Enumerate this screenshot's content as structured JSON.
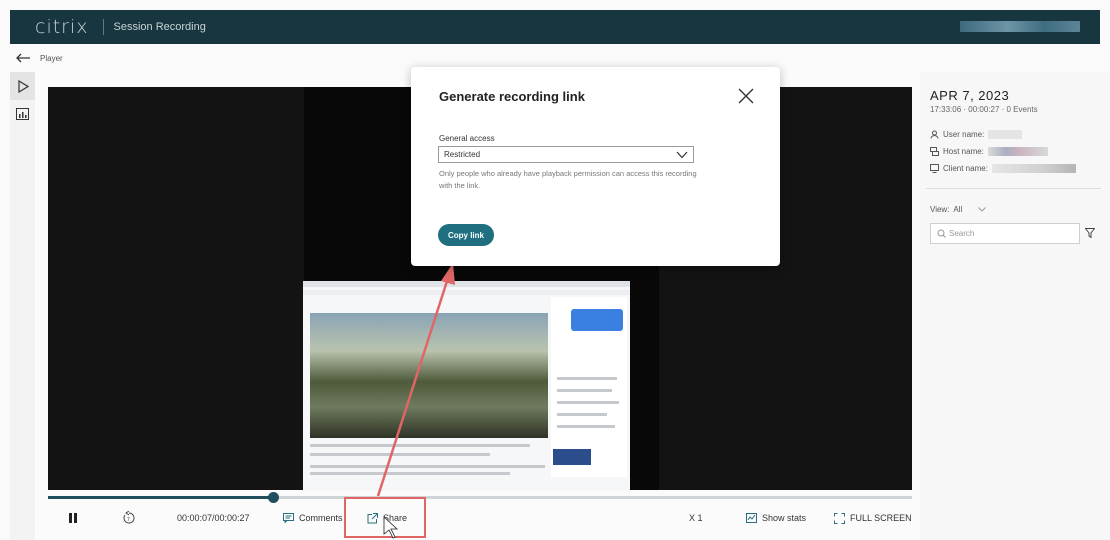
{
  "header": {
    "logo": "citrix",
    "app_title": "Session Recording"
  },
  "breadcrumb": {
    "label": "Player"
  },
  "player": {
    "time": "00:00:07/00:00:27",
    "progress_fraction": 0.26,
    "controls": {
      "comments": "Comments",
      "share": "Share",
      "speed": "X 1",
      "show_stats": "Show stats",
      "fullscreen": "FULL SCREEN"
    }
  },
  "side_panel": {
    "date": "APR 7, 2023",
    "meta": "17:33:06 · 00:00:27 · 0 Events",
    "user_label": "User name:",
    "host_label": "Host name:",
    "client_label": "Client name:",
    "view_label": "View:",
    "view_value": "All",
    "search_placeholder": "Search"
  },
  "modal": {
    "title": "Generate recording link",
    "field_label": "General access",
    "selected_option": "Restricted",
    "helper_text": "Only people who already have playback permission can access this recording with the link.",
    "copy_button": "Copy link"
  },
  "colors": {
    "header_bg": "#17363f",
    "accent": "#1f6f80",
    "annotation": "#e06666"
  }
}
